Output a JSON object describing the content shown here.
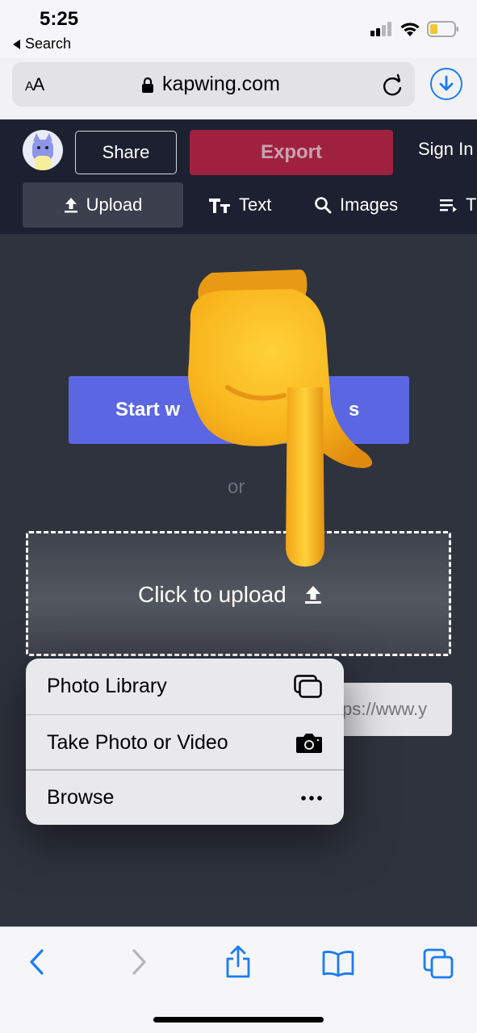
{
  "status_bar": {
    "time": "5:25",
    "back_label": "Search"
  },
  "address_bar": {
    "text_size_label": "AA",
    "domain": "kapwing.com"
  },
  "header": {
    "share_label": "Share",
    "export_label": "Export",
    "sign_in_label": "Sign In",
    "tabs": [
      {
        "label": "Upload",
        "icon": "upload-icon"
      },
      {
        "label": "Text",
        "icon": "text-icon"
      },
      {
        "label": "Images",
        "icon": "search-icon"
      },
      {
        "label": "T",
        "icon": "list-icon"
      }
    ]
  },
  "main": {
    "start_button_left": "Start w",
    "start_button_right": "s",
    "or_label": "or",
    "upload_label": "Click to upload",
    "url_input_partial": "ps://www.y"
  },
  "menu": {
    "items": [
      {
        "label": "Photo Library",
        "icon": "photo-library-icon"
      },
      {
        "label": "Take Photo or Video",
        "icon": "camera-icon"
      },
      {
        "label": "Browse",
        "icon": "more-icon"
      }
    ]
  },
  "colors": {
    "header_bg": "#1d2030",
    "main_bg": "#2f333e",
    "export": "#a0213f",
    "start_button": "#5b66e2",
    "ios_blue": "#1a7cf5"
  }
}
